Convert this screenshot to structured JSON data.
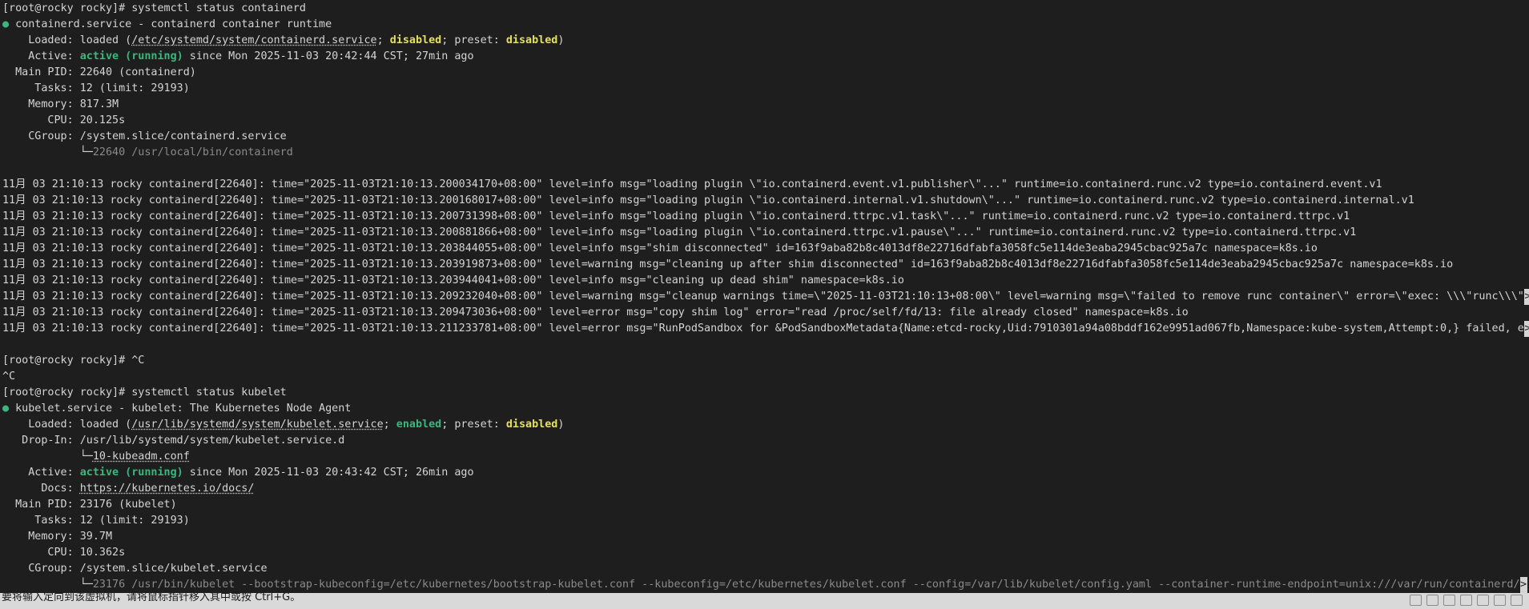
{
  "terminal": {
    "cmd1": "[root@rocky rocky]# systemctl status containerd",
    "containerd": {
      "dot": "●",
      "header": " containerd.service - containerd container runtime",
      "loaded_label": "    Loaded: ",
      "loaded_pre": "loaded (",
      "loaded_path": "/etc/systemd/system/containerd.service",
      "loaded_sep": "; ",
      "loaded_state": "disabled",
      "loaded_preset_label": "; preset: ",
      "loaded_preset": "disabled",
      "loaded_close": ")",
      "active_label": "    Active: ",
      "active_state": "active (running)",
      "active_since": " since Mon 2025-11-03 20:42:44 CST; 27min ago",
      "mainpid": "  Main PID: 22640 (containerd)",
      "tasks": "     Tasks: 12 (limit: 29193)",
      "memory": "    Memory: 817.3M",
      "cpu": "       CPU: 20.125s",
      "cgroup": "    CGroup: /system.slice/containerd.service",
      "cgroup_tree": "            └─",
      "cgroup_proc": "22640 /usr/local/bin/containerd"
    },
    "log_lines": [
      "11月 03 21:10:13 rocky containerd[22640]: time=\"2025-11-03T21:10:13.200034170+08:00\" level=info msg=\"loading plugin \\\"io.containerd.event.v1.publisher\\\"...\" runtime=io.containerd.runc.v2 type=io.containerd.event.v1",
      "11月 03 21:10:13 rocky containerd[22640]: time=\"2025-11-03T21:10:13.200168017+08:00\" level=info msg=\"loading plugin \\\"io.containerd.internal.v1.shutdown\\\"...\" runtime=io.containerd.runc.v2 type=io.containerd.internal.v1",
      "11月 03 21:10:13 rocky containerd[22640]: time=\"2025-11-03T21:10:13.200731398+08:00\" level=info msg=\"loading plugin \\\"io.containerd.ttrpc.v1.task\\\"...\" runtime=io.containerd.runc.v2 type=io.containerd.ttrpc.v1",
      "11月 03 21:10:13 rocky containerd[22640]: time=\"2025-11-03T21:10:13.200881866+08:00\" level=info msg=\"loading plugin \\\"io.containerd.ttrpc.v1.pause\\\"...\" runtime=io.containerd.runc.v2 type=io.containerd.ttrpc.v1",
      "11月 03 21:10:13 rocky containerd[22640]: time=\"2025-11-03T21:10:13.203844055+08:00\" level=info msg=\"shim disconnected\" id=163f9aba82b8c4013df8e22716dfabfa3058fc5e114de3eaba2945cbac925a7c namespace=k8s.io",
      "11月 03 21:10:13 rocky containerd[22640]: time=\"2025-11-03T21:10:13.203919873+08:00\" level=warning msg=\"cleaning up after shim disconnected\" id=163f9aba82b8c4013df8e22716dfabfa3058fc5e114de3eaba2945cbac925a7c namespace=k8s.io",
      "11月 03 21:10:13 rocky containerd[22640]: time=\"2025-11-03T21:10:13.203944041+08:00\" level=info msg=\"cleaning up dead shim\" namespace=k8s.io"
    ],
    "log_trunc_1": "11月 03 21:10:13 rocky containerd[22640]: time=\"2025-11-03T21:10:13.209232040+08:00\" level=warning msg=\"cleanup warnings time=\\\"2025-11-03T21:10:13+08:00\\\" level=warning msg=\\\"failed to remove runc container\\\" error=\\\"exec: \\\\\\\"runc\\\\\\\"",
    "log_line_copy": "11月 03 21:10:13 rocky containerd[22640]: time=\"2025-11-03T21:10:13.209473036+08:00\" level=error msg=\"copy shim log\" error=\"read /proc/self/fd/13: file already closed\" namespace=k8s.io",
    "log_trunc_2": "11月 03 21:10:13 rocky containerd[22640]: time=\"2025-11-03T21:10:13.211233781+08:00\" level=error msg=\"RunPodSandbox for &PodSandboxMetadata{Name:etcd-rocky,Uid:7910301a94a08bddf162e9951ad067fb,Namespace:kube-system,Attempt:0,} failed, e",
    "trunc_marker": ">",
    "ctrl_c_prompt": "[root@rocky rocky]# ^C",
    "ctrl_c_echo": "^C",
    "cmd2": "[root@rocky rocky]# systemctl status kubelet",
    "kubelet": {
      "dot": "●",
      "header": " kubelet.service - kubelet: The Kubernetes Node Agent",
      "loaded_label": "    Loaded: ",
      "loaded_pre": "loaded (",
      "loaded_path": "/usr/lib/systemd/system/kubelet.service",
      "loaded_sep": "; ",
      "loaded_state": "enabled",
      "loaded_preset_label": "; preset: ",
      "loaded_preset": "disabled",
      "loaded_close": ")",
      "dropin": "   Drop-In: /usr/lib/systemd/system/kubelet.service.d",
      "dropin_tree": "            └─",
      "dropin_file": "10-kubeadm.conf",
      "active_label": "    Active: ",
      "active_state": "active (running)",
      "active_since": " since Mon 2025-11-03 20:43:42 CST; 26min ago",
      "docs_label": "      Docs: ",
      "docs_url": "https://kubernetes.io/docs/",
      "mainpid": "  Main PID: 23176 (kubelet)",
      "tasks": "     Tasks: 12 (limit: 29193)",
      "memory": "    Memory: 39.7M",
      "cpu": "       CPU: 10.362s",
      "cgroup": "    CGroup: /system.slice/kubelet.service",
      "cgroup_tree": "            └─",
      "cgroup_proc": "23176 /usr/bin/kubelet --bootstrap-kubeconfig=/etc/kubernetes/bootstrap-kubelet.conf --kubeconfig=/etc/kubernetes/kubelet.conf --config=/var/lib/kubelet/config.yaml --container-runtime-endpoint=unix:///var/run/containerd/"
    }
  },
  "statusbar": {
    "message": "要将输入定向到该虚拟机，请将鼠标指针移入其中或按 Ctrl+G。"
  },
  "colors": {
    "background": "#1e1e1e",
    "foreground": "#d4d4d4",
    "active_green": "#3bb77e",
    "state_yellow": "#e5e05b"
  }
}
